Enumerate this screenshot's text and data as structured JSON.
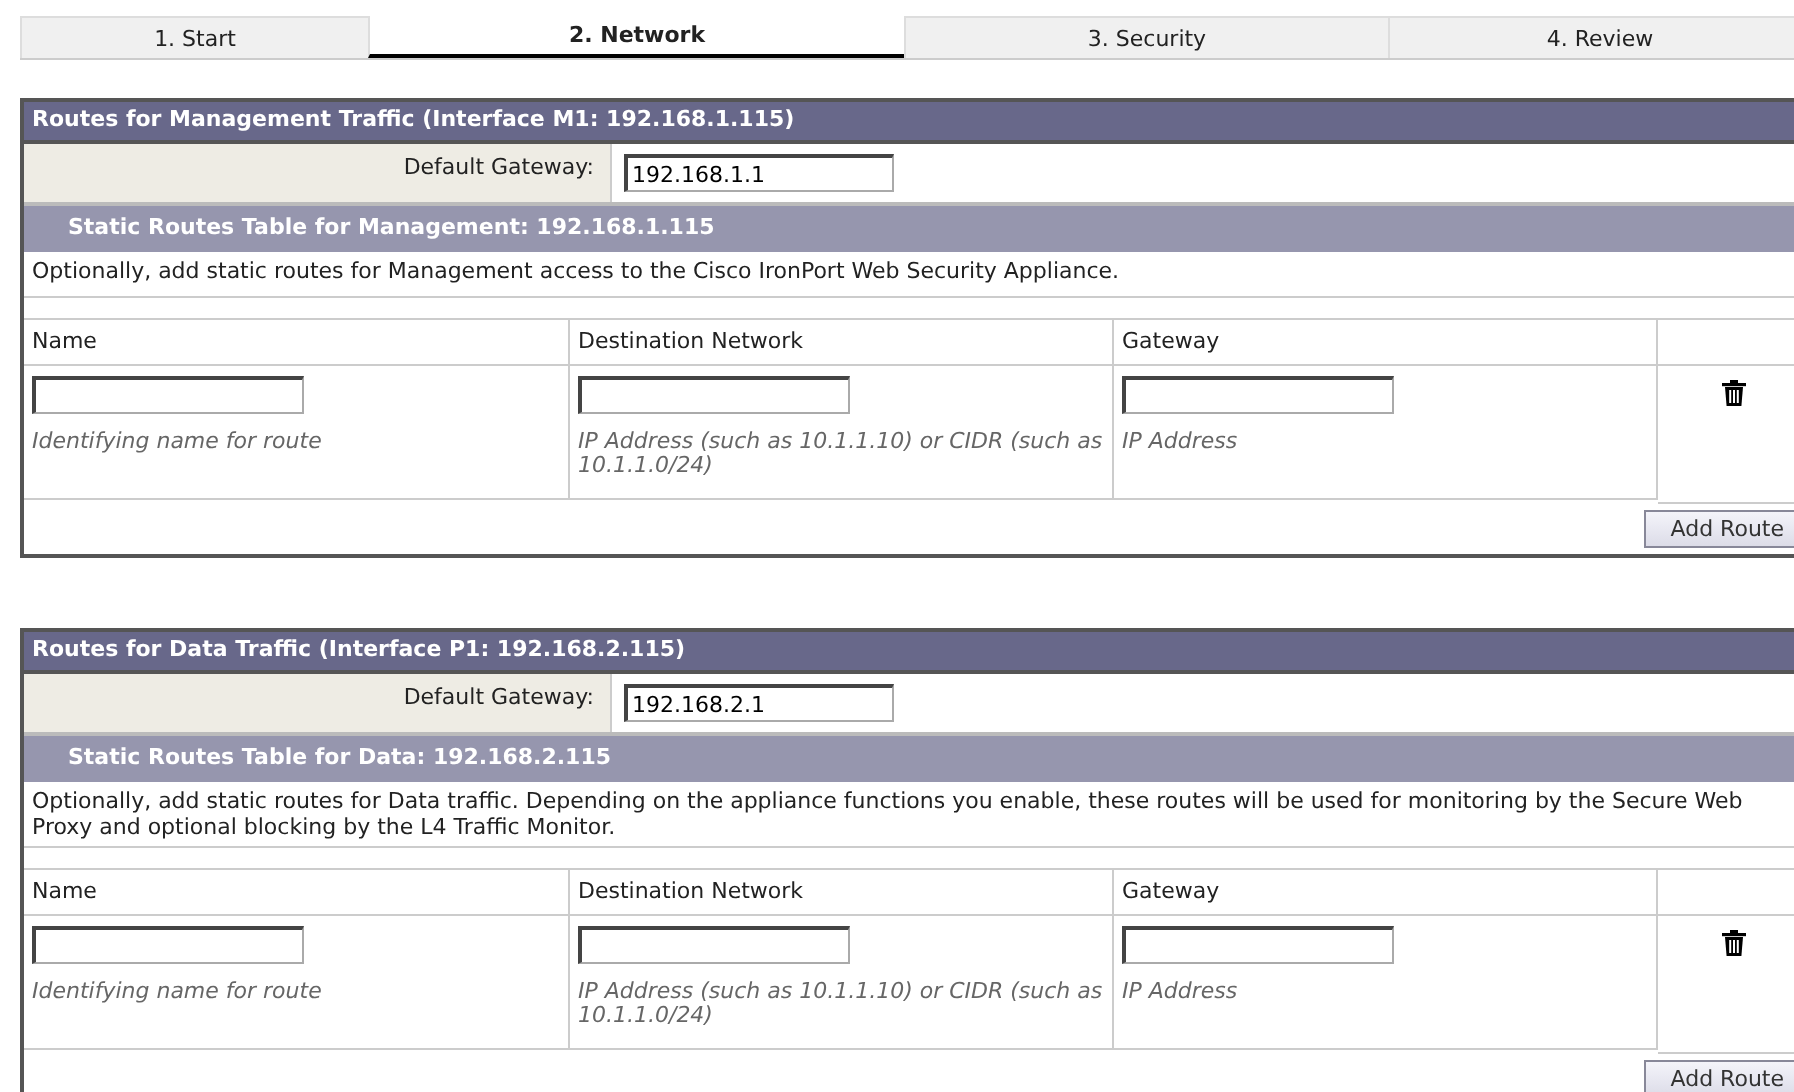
{
  "tabs": [
    {
      "label": "1. Start",
      "selected": false
    },
    {
      "label": "2. Network",
      "selected": true
    },
    {
      "label": "3. Security",
      "selected": false
    },
    {
      "label": "4. Review",
      "selected": false
    }
  ],
  "sections": [
    {
      "title": "Routes for Management Traffic (Interface M1: 192.168.1.115)",
      "gateway_label": "Default Gateway:",
      "gateway_value": "192.168.1.1",
      "subtitle": "Static Routes Table for Management: 192.168.1.115",
      "description": "Optionally, add static routes for Management access to the Cisco IronPort Web Security Appliance.",
      "columns": [
        "Name",
        "Destination Network",
        "Gateway"
      ],
      "row_hints": [
        "Identifying name for route",
        "IP Address (such as 10.1.1.10) or CIDR (such as 10.1.1.0/24)",
        "IP Address"
      ],
      "button": "Add Route"
    },
    {
      "title": "Routes for Data Traffic (Interface P1: 192.168.2.115)",
      "gateway_label": "Default Gateway:",
      "gateway_value": "192.168.2.1",
      "subtitle": "Static Routes Table for Data: 192.168.2.115",
      "description": "Optionally, add static routes for Data traffic. Depending on the appliance functions you enable, these routes will be used for monitoring by the Secure Web Proxy and optional blocking by the L4 Traffic Monitor.",
      "columns": [
        "Name",
        "Destination Network",
        "Gateway"
      ],
      "row_hints": [
        "Identifying name for route",
        "IP Address (such as 10.1.1.10) or CIDR (such as 10.1.1.0/24)",
        "IP Address"
      ],
      "button": "Add Route"
    }
  ]
}
